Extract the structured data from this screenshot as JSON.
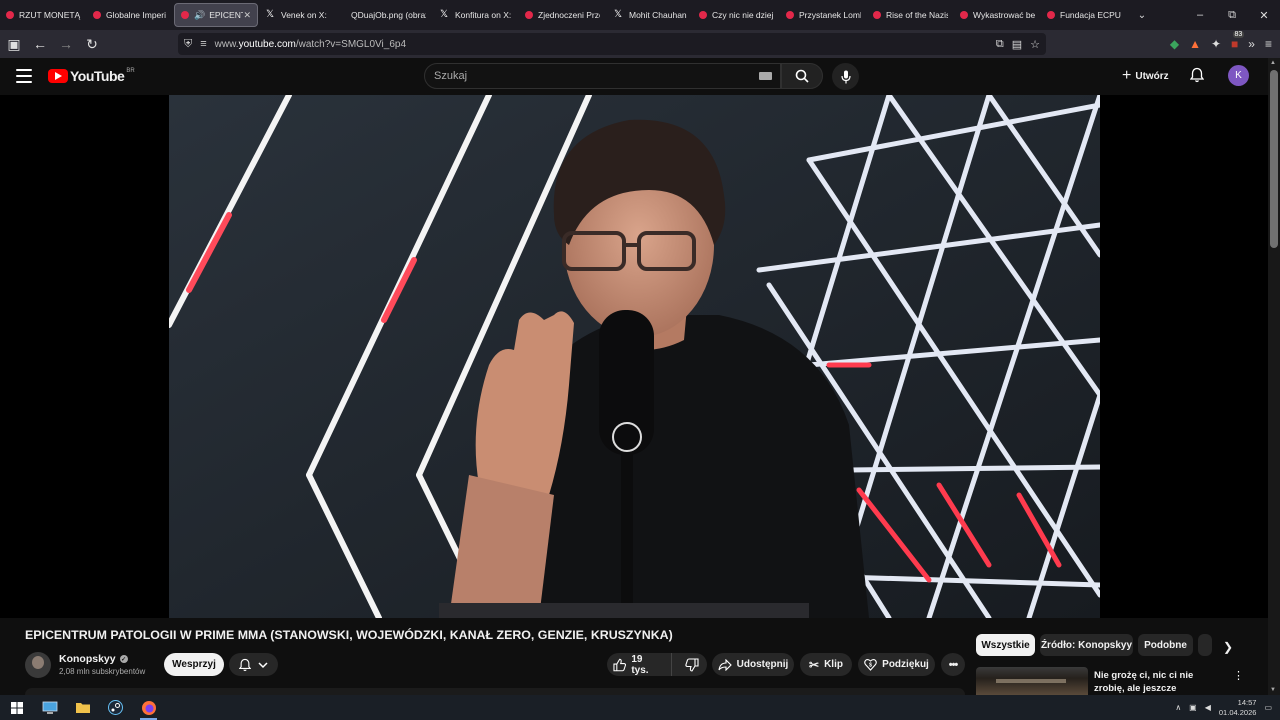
{
  "browser": {
    "tabs": [
      {
        "label": "RZUT MONETĄ (",
        "icon": "youtube-icon"
      },
      {
        "label": "Globalne Imperi",
        "icon": "youtube-icon"
      },
      {
        "label": "EPICENTR",
        "icon": "youtube-icon",
        "active": true
      },
      {
        "label": "Venek on X:",
        "icon": "x-icon"
      },
      {
        "label": "QDuajOb.png (obraz",
        "icon": "none"
      },
      {
        "label": "Konfitura on X: \"",
        "icon": "x-icon"
      },
      {
        "label": "Zjednoczeni Prze",
        "icon": "youtube-icon"
      },
      {
        "label": "Mohit Chauhan -",
        "icon": "x-icon"
      },
      {
        "label": "Czy nic nie dziej",
        "icon": "youtube-icon"
      },
      {
        "label": "Przystanek Lomb",
        "icon": "youtube-icon"
      },
      {
        "label": "Rise of the Nazis",
        "icon": "youtube-icon"
      },
      {
        "label": "Wykastrować be",
        "icon": "youtube-icon"
      },
      {
        "label": "Fundacja ECPU F",
        "icon": "youtube-icon"
      }
    ],
    "url_prefix": "www.",
    "url_domain": "youtube.com",
    "url_path": "/watch?v=SMGL0Vi_6p4",
    "extension_badge": "83"
  },
  "youtube": {
    "logo_text": "YouTube",
    "country_code": "BR",
    "search_placeholder": "Szukaj",
    "create_label": "Utwórz",
    "avatar_letter": "K",
    "accent_color": "#ff0000"
  },
  "video": {
    "title": "EPICENTRUM PATOLOGII W PRIME MMA (STANOWSKI, WOJEWÓDZKI, KANAŁ ZERO, GENZIE, KRUSZYNKA)",
    "channel_name": "Konopskyy",
    "subscribers": "2,08 mln subskrybentów",
    "support_label": "Wesprzyj",
    "likes": "19 tys.",
    "share_label": "Udostępnij",
    "clip_label": "Klip",
    "thanks_label": "Podziękuj"
  },
  "chips": [
    "Wszystkie",
    "Źródło: Konopskyy",
    "Podobne"
  ],
  "recommendation": {
    "title": "Nie grożę ci, nic ci nie zrobię, ale jeszcze zobaczysz w ..."
  },
  "taskbar": {
    "time": "14:57",
    "date": "01.04.2026"
  }
}
